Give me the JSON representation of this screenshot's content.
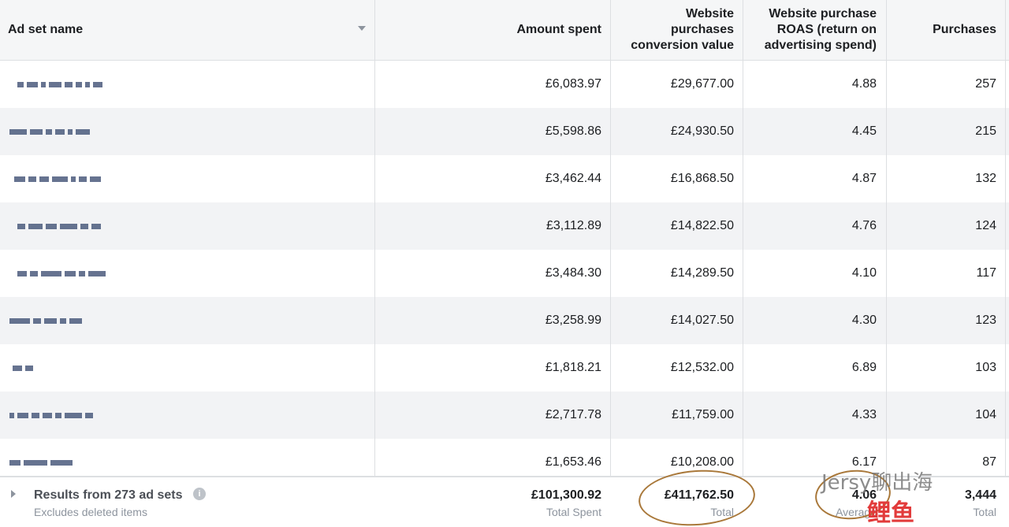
{
  "header": {
    "ad_set_name": "Ad set name",
    "amount_spent": "Amount spent",
    "conversion_value": [
      "Website",
      "purchases",
      "conversion value"
    ],
    "roas": [
      "Website purchase",
      "ROAS (return on",
      "advertising spend)"
    ],
    "purchases": "Purchases"
  },
  "rows": [
    {
      "amount": "£6,083.97",
      "value": "£29,677.00",
      "roas": "4.88",
      "purchases": "257"
    },
    {
      "amount": "£5,598.86",
      "value": "£24,930.50",
      "roas": "4.45",
      "purchases": "215"
    },
    {
      "amount": "£3,462.44",
      "value": "£16,868.50",
      "roas": "4.87",
      "purchases": "132"
    },
    {
      "amount": "£3,112.89",
      "value": "£14,822.50",
      "roas": "4.76",
      "purchases": "124"
    },
    {
      "amount": "£3,484.30",
      "value": "£14,289.50",
      "roas": "4.10",
      "purchases": "117"
    },
    {
      "amount": "£3,258.99",
      "value": "£14,027.50",
      "roas": "4.30",
      "purchases": "123"
    },
    {
      "amount": "£1,818.21",
      "value": "£12,532.00",
      "roas": "6.89",
      "purchases": "103"
    },
    {
      "amount": "£2,717.78",
      "value": "£11,759.00",
      "roas": "4.33",
      "purchases": "104"
    },
    {
      "amount": "£1,653.46",
      "value": "£10,208.00",
      "roas": "6.17",
      "purchases": "87"
    }
  ],
  "footer": {
    "results_label": "Results from 273 ad sets",
    "excludes_label": "Excludes deleted items",
    "info_icon": "i",
    "total_spent": "£101,300.92",
    "total_spent_label": "Total Spent",
    "total_value": "£411,762.50",
    "total_value_label": "Total",
    "average_roas": "4.06",
    "average_label": "Average",
    "total_purchases": "3,444",
    "total_purchases_label": "Total"
  },
  "watermark": {
    "text": "Jersy聊出海",
    "red_text": "鲤鱼"
  },
  "icons": {
    "sort": "chevron-down-icon",
    "expand": "chevron-right-icon",
    "info": "info-icon"
  },
  "colors": {
    "header_bg": "#f5f6f7",
    "stripe_bg": "#f2f3f5",
    "border": "#dddfe2",
    "annotation_circle": "#a9783a"
  }
}
